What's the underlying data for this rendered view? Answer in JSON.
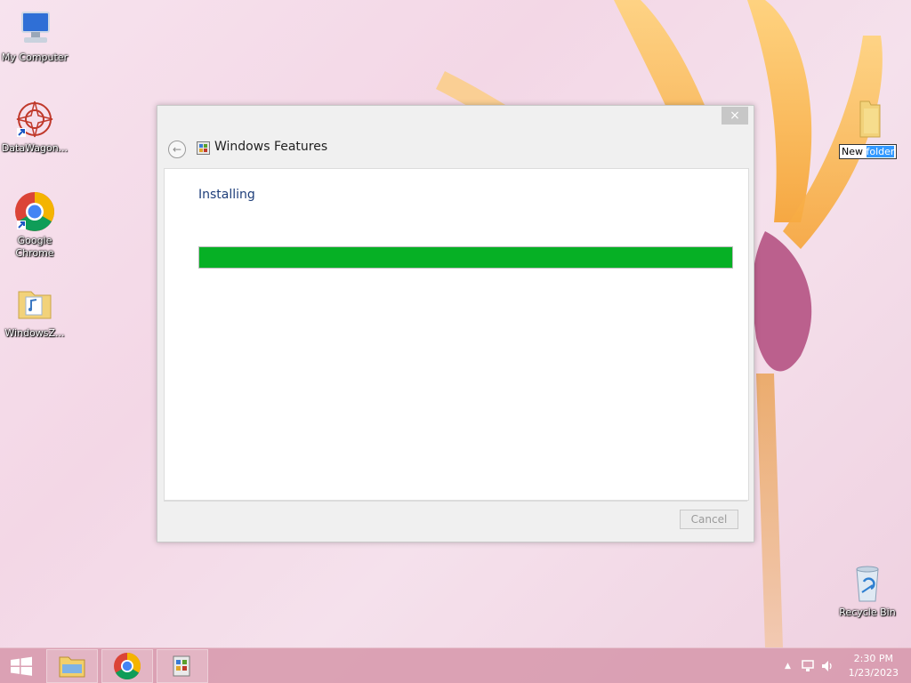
{
  "desktop": {
    "icons": [
      {
        "label": "My Computer",
        "icon": "computer-icon"
      },
      {
        "label": "DataWagon...",
        "icon": "datawagon-icon"
      },
      {
        "label": "Google Chrome",
        "icon": "chrome-icon"
      },
      {
        "label": "WindowsZ...",
        "icon": "folder-icon"
      }
    ],
    "recycle_bin": {
      "label": "Recycle Bin",
      "icon": "recycle-bin-icon"
    },
    "new_folder": {
      "name_unselected": "New ",
      "name_selected": "folder",
      "icon": "folder-icon"
    }
  },
  "dialog": {
    "title": "Windows Features",
    "close_glyph": "×",
    "back_glyph": "←",
    "status": "Installing",
    "progress": 1.0,
    "cancel_label": "Cancel"
  },
  "taskbar": {
    "pinned": [
      "file-explorer-icon",
      "chrome-icon",
      "windows-features-icon"
    ],
    "clock_time": "2:30 PM",
    "clock_date": "1/23/2023",
    "tray_arrow": "▲"
  },
  "colors": {
    "progress_fill": "#06b025",
    "status_text": "#1e3e7a",
    "taskbar": "#d696aa"
  }
}
